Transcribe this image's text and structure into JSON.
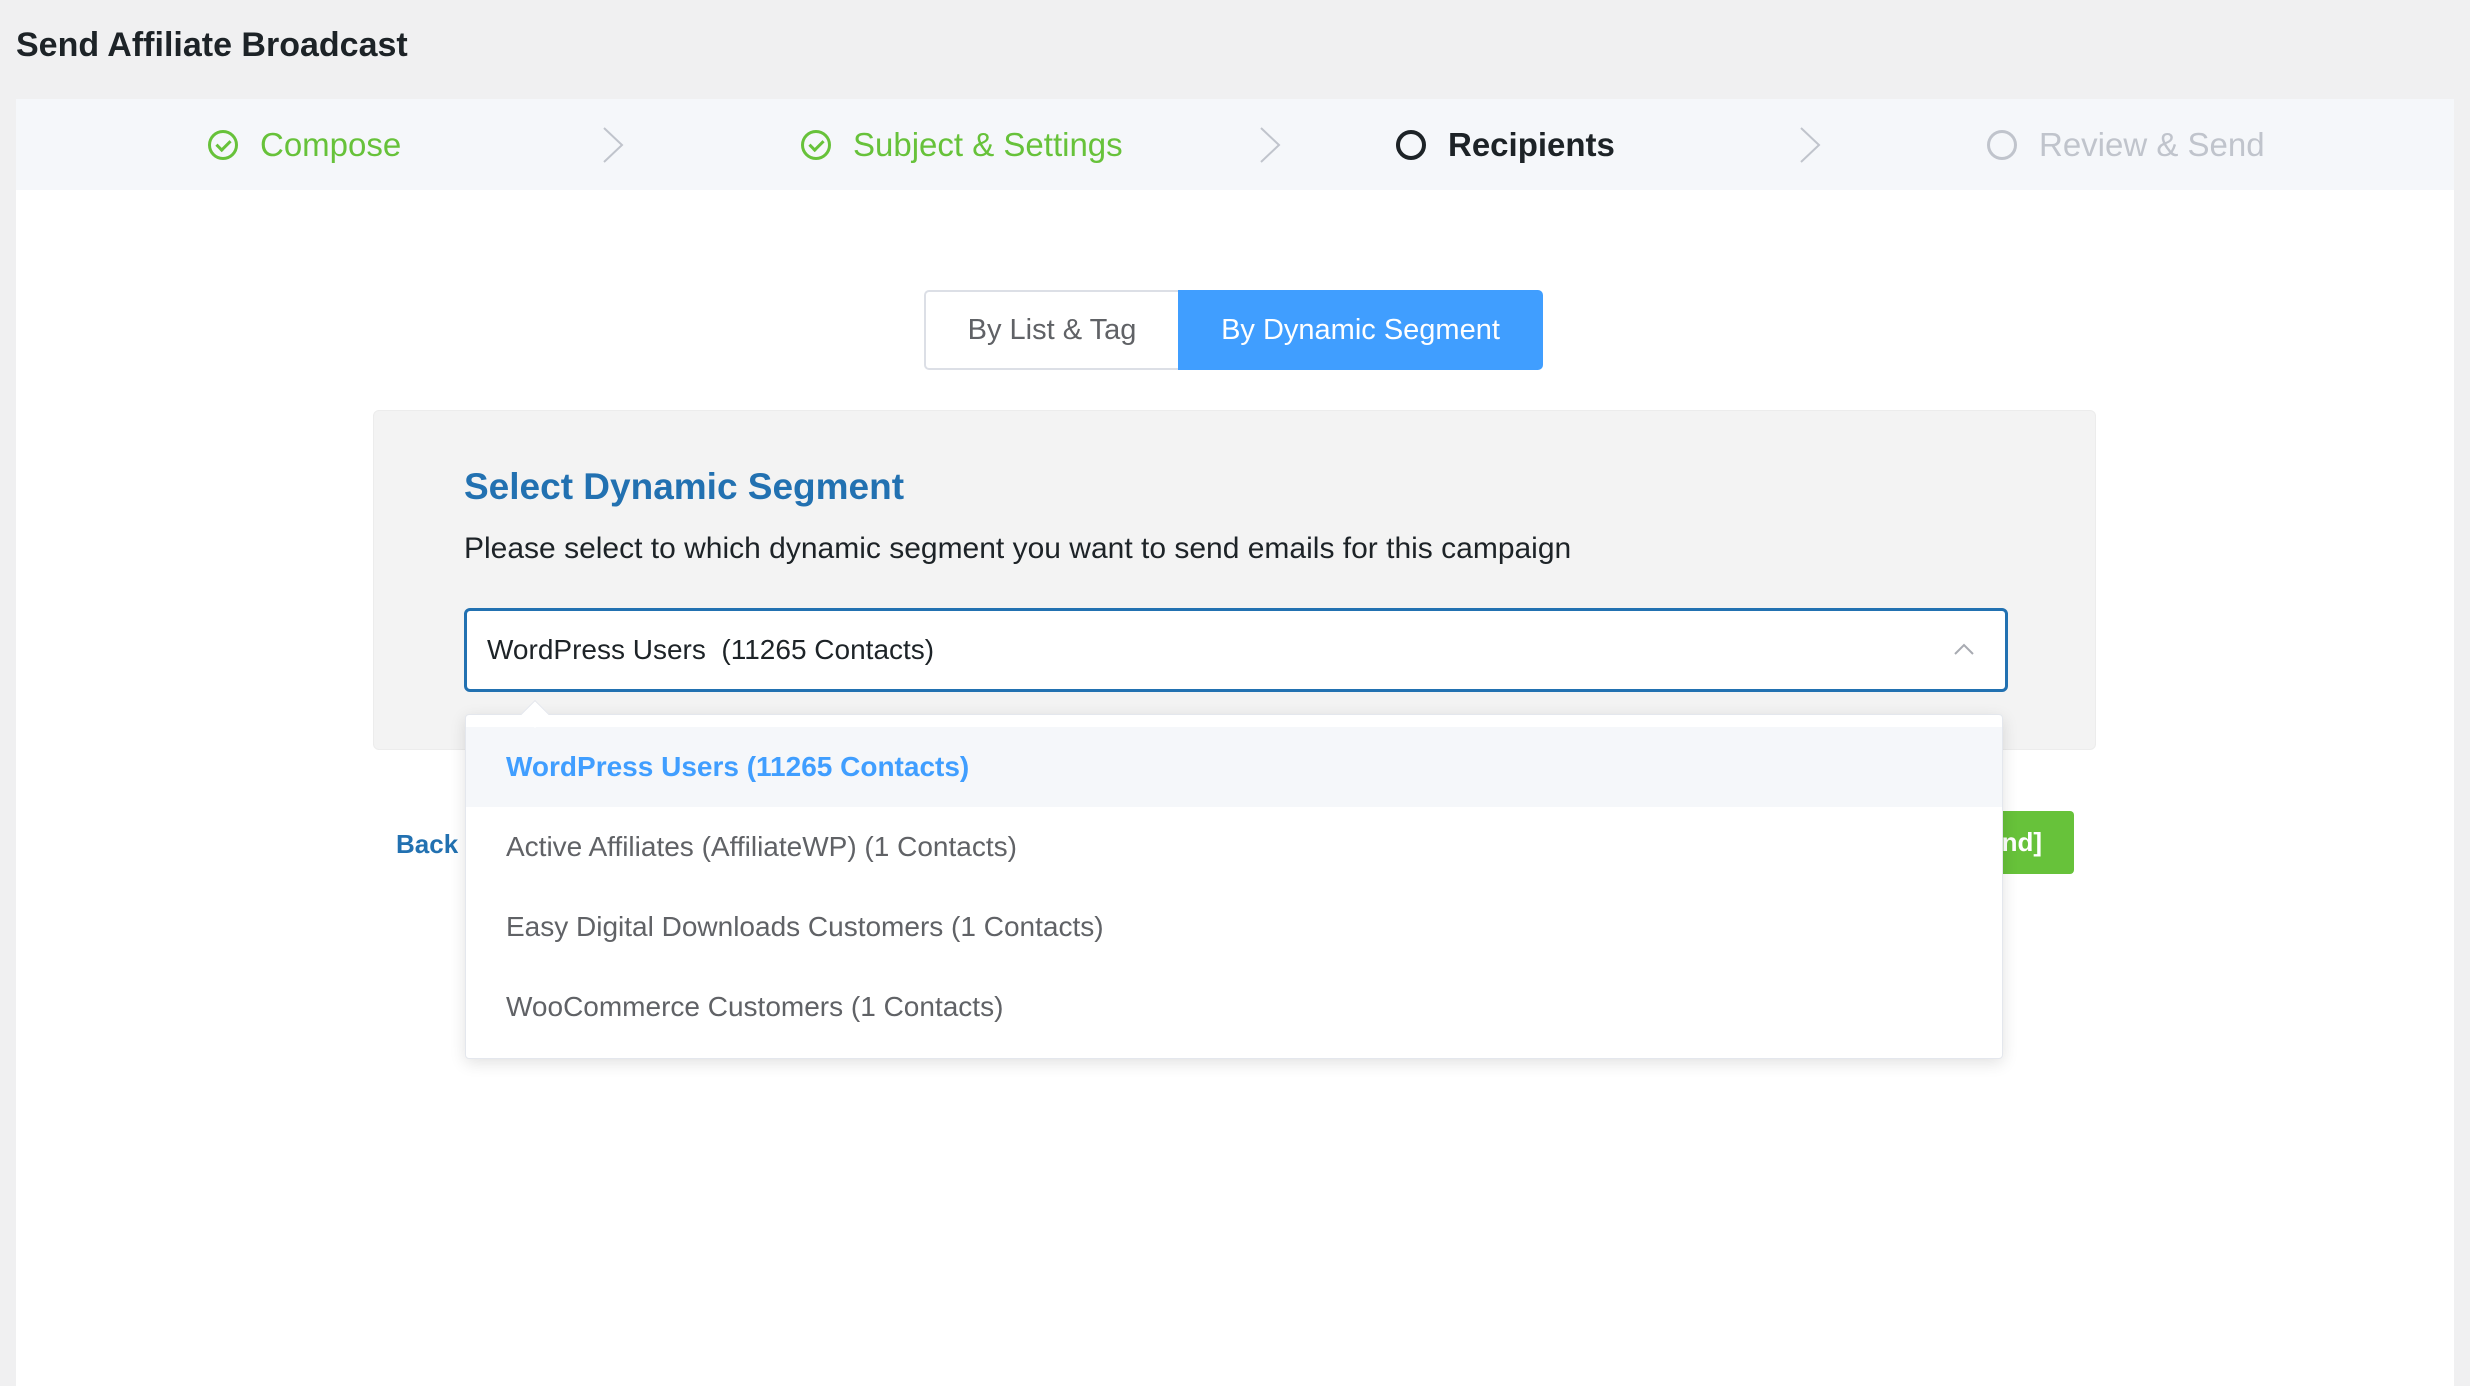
{
  "page": {
    "title": "Send Affiliate Broadcast"
  },
  "steps": [
    {
      "label": "Compose",
      "state": "done",
      "icon": "check-circle-icon"
    },
    {
      "label": "Subject & Settings",
      "state": "done",
      "icon": "check-circle-icon"
    },
    {
      "label": "Recipients",
      "state": "active",
      "icon": "circle-icon"
    },
    {
      "label": "Review & Send",
      "state": "pending",
      "icon": "circle-icon"
    }
  ],
  "tabs": {
    "list_tag": "By List & Tag",
    "dynamic_segment": "By Dynamic Segment",
    "active": "dynamic_segment"
  },
  "segment_panel": {
    "title": "Select Dynamic Segment",
    "description": "Please select to which dynamic segment you want to send emails for this campaign",
    "selected_value": "WordPress Users  (11265 Contacts)",
    "options": [
      "WordPress Users (11265 Contacts)",
      "Active Affiliates (AffiliateWP) (1 Contacts)",
      "Easy Digital Downloads Customers (1 Contacts)",
      "WooCommerce Customers (1 Contacts)"
    ],
    "selected_index": 0
  },
  "footer": {
    "back_label": "Back",
    "send_label_visible": "nd]"
  },
  "colors": {
    "done": "#67c23a",
    "active": "#1d2327",
    "pending": "#c0c4cc",
    "primary": "#409eff",
    "title_blue": "#2271b1"
  }
}
